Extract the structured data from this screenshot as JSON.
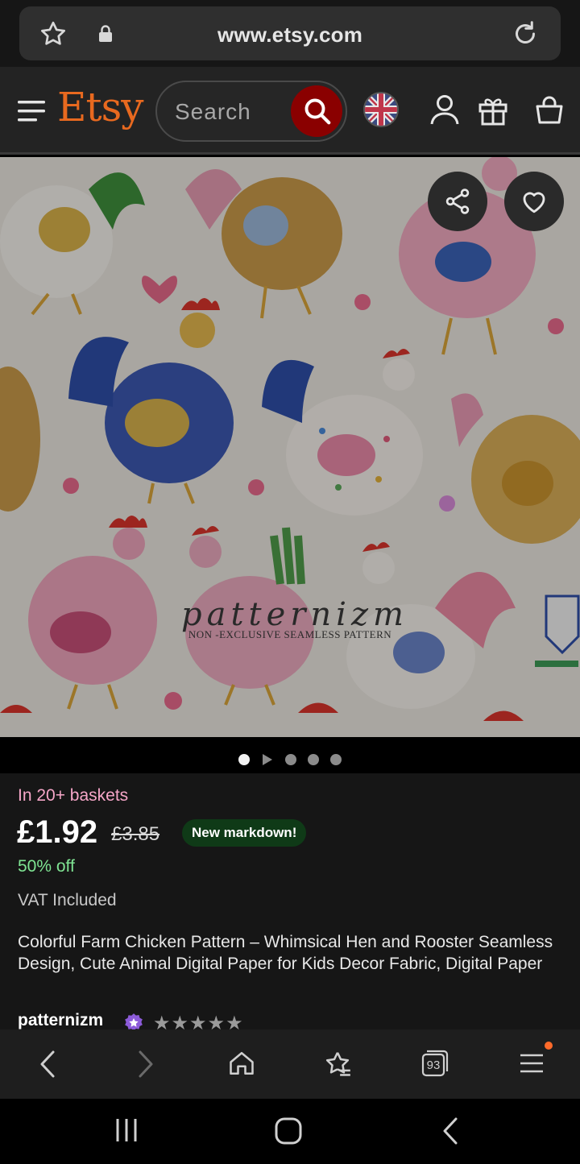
{
  "browser": {
    "url": "www.etsy.com",
    "tab_count": "93"
  },
  "header": {
    "logo": "Etsy",
    "search_placeholder": "Search"
  },
  "gallery": {
    "watermark_title": "patternizm",
    "watermark_subtitle": "NON -EXCLUSIVE SEAMLESS PATTERN",
    "dots": [
      "active",
      "play",
      "inactive",
      "inactive",
      "inactive"
    ]
  },
  "product": {
    "baskets": "In 20+ baskets",
    "price": "£1.92",
    "old_price": "£3.85",
    "markdown_badge": "New markdown!",
    "discount": "50% off",
    "vat": "VAT Included",
    "title": "Colorful Farm Chicken Pattern – Whimsical Hen and Rooster Seamless Design, Cute Animal Digital Paper for Kids Decor Fabric, Digital Paper",
    "shop_name": "patternizm",
    "rating_stars": "★★★★★"
  },
  "colors": {
    "brand": "#e8691f",
    "search_button": "#8a0000",
    "baskets_text": "#f6a6c8",
    "discount_text": "#7fe493",
    "markdown_bg": "#0f3a17"
  }
}
